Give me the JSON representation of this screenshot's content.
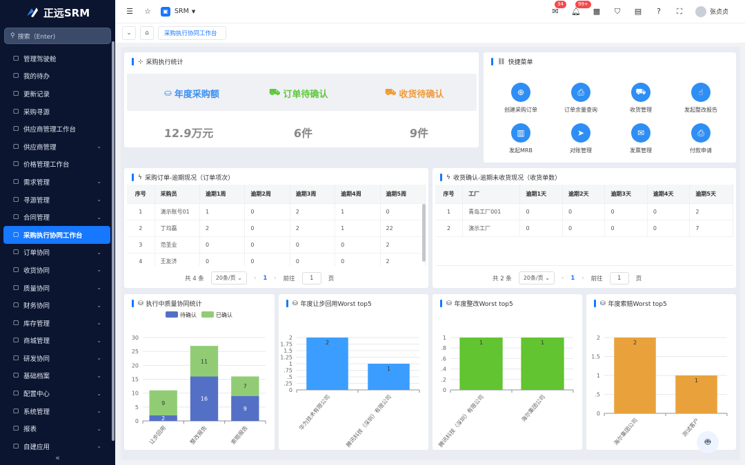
{
  "app": {
    "title": "正远SRM",
    "search_placeholder": "搜索（Enter)"
  },
  "sidebar": {
    "items": [
      {
        "label": "管理驾驶舱",
        "icon": "dashboard-icon",
        "chev": false
      },
      {
        "label": "我的待办",
        "icon": "user-icon",
        "chev": false
      },
      {
        "label": "更新记录",
        "icon": "box-icon",
        "chev": false
      },
      {
        "label": "采购寻源",
        "icon": "sparkle-icon",
        "chev": false
      },
      {
        "label": "供应商管理工作台",
        "icon": "monitor-icon",
        "chev": false
      },
      {
        "label": "供应商管理",
        "icon": "building-icon",
        "chev": true
      },
      {
        "label": "价格管理工作台",
        "icon": "monitor-icon",
        "chev": false
      },
      {
        "label": "需求管理",
        "icon": "folder-icon",
        "chev": true
      },
      {
        "label": "寻源管理",
        "icon": "inbox-icon",
        "chev": true
      },
      {
        "label": "合同管理",
        "icon": "person-icon",
        "chev": true
      },
      {
        "label": "采购执行协同工作台",
        "icon": "monitor-icon",
        "chev": false,
        "active": true
      },
      {
        "label": "订单协同",
        "icon": "monitor-icon",
        "chev": true
      },
      {
        "label": "收货协同",
        "icon": "box-icon",
        "chev": true
      },
      {
        "label": "质量协同",
        "icon": "shield-icon",
        "chev": true
      },
      {
        "label": "财务协同",
        "icon": "eye-icon",
        "chev": true
      },
      {
        "label": "库存管理",
        "icon": "warehouse-icon",
        "chev": true
      },
      {
        "label": "商城管理",
        "icon": "shop-icon",
        "chev": true
      },
      {
        "label": "研发协同",
        "icon": "briefcase-icon",
        "chev": true
      },
      {
        "label": "基础档案",
        "icon": "car-icon",
        "chev": true
      },
      {
        "label": "配置中心",
        "icon": "calendar-icon",
        "chev": true
      },
      {
        "label": "系统管理",
        "icon": "gear-icon",
        "chev": true
      },
      {
        "label": "报表",
        "icon": "chart-icon",
        "chev": true
      },
      {
        "label": "自建应用",
        "icon": "home-icon",
        "chev": true
      }
    ]
  },
  "topbar": {
    "module": "SRM",
    "badge1": "34",
    "badge2": "99+",
    "user": "张贞贞"
  },
  "tabs": {
    "active": "采购执行协同工作台"
  },
  "stats": {
    "title": "采购执行统计",
    "items": [
      {
        "label": "年度采购额",
        "value": "12.9万元",
        "color": "#3b8ff0"
      },
      {
        "label": "订单待确认",
        "value": "6件",
        "color": "#5cc83a"
      },
      {
        "label": "收货待确认",
        "value": "9件",
        "color": "#f09a36"
      }
    ]
  },
  "quick": {
    "title": "快捷菜单",
    "items": [
      {
        "label": "创建采购订单",
        "icon": "cart-plus-icon"
      },
      {
        "label": "订单余量查询",
        "icon": "printer-icon"
      },
      {
        "label": "收货管理",
        "icon": "truck-icon"
      },
      {
        "label": "发起整改报告",
        "icon": "hand-icon"
      },
      {
        "label": "发起MRB",
        "icon": "book-icon"
      },
      {
        "label": "对账管理",
        "icon": "send-icon"
      },
      {
        "label": "发票管理",
        "icon": "mail-icon"
      },
      {
        "label": "付款申请",
        "icon": "print-icon"
      }
    ]
  },
  "overdue_orders": {
    "title": "采购订单-逾期现况（订单项次）",
    "headers": [
      "序号",
      "采购员",
      "逾期1周",
      "逾期2周",
      "逾期3周",
      "逾期4周",
      "逾期5周"
    ],
    "rows": [
      [
        "1",
        "演示账号01",
        "1",
        "0",
        "2",
        "1",
        "0"
      ],
      [
        "2",
        "丁均磊",
        "2",
        "0",
        "2",
        "1",
        "22"
      ],
      [
        "3",
        "范圣业",
        "0",
        "0",
        "0",
        "0",
        "2"
      ],
      [
        "4",
        "王友济",
        "0",
        "0",
        "0",
        "0",
        "2"
      ]
    ],
    "total": "共 4 条",
    "page_size": "20条/页",
    "page": "1",
    "goto": "前往",
    "goto_val": "1",
    "page_unit": "页"
  },
  "overdue_receipts": {
    "title": "收货确认-逾期未收货现况（收货单数）",
    "headers": [
      "序号",
      "工厂",
      "逾期1天",
      "逾期2天",
      "逾期3天",
      "逾期4天",
      "逾期5天"
    ],
    "rows": [
      [
        "1",
        "青岛工厂001",
        "0",
        "0",
        "0",
        "0",
        "2"
      ],
      [
        "2",
        "演示工厂",
        "0",
        "0",
        "0",
        "0",
        "7"
      ]
    ],
    "total": "共 2 条",
    "page_size": "20条/页",
    "page": "1",
    "goto": "前往",
    "goto_val": "1",
    "page_unit": "页"
  },
  "chart_data": [
    {
      "type": "bar",
      "title": "执行中质量协同统计",
      "stacked": true,
      "categories": [
        "让步回用",
        "整改报告",
        "索赔报告"
      ],
      "series": [
        {
          "name": "待确认",
          "values": [
            2,
            16,
            9
          ],
          "color": "#5470c6"
        },
        {
          "name": "已确认",
          "values": [
            9,
            11,
            7
          ],
          "color": "#91cc75"
        }
      ],
      "ylim": [
        0,
        30
      ],
      "yticks": [
        0,
        5,
        10,
        15,
        20,
        25,
        30
      ],
      "legend": "top"
    },
    {
      "type": "bar",
      "title": "年度让步回用Worst top5",
      "categories": [
        "华为技术有限公司",
        "腾讯科技（深圳）有限公司"
      ],
      "values": [
        2,
        1
      ],
      "color": "#3b9dff",
      "ylim": [
        0,
        2
      ],
      "yticks": [
        0,
        0.25,
        0.5,
        0.75,
        1,
        1.25,
        1.5,
        1.75,
        2
      ],
      "ytick_labels": [
        "0",
        ".25",
        ".5",
        ".75",
        "1",
        "1.25",
        "1.5",
        "1.75",
        "2"
      ]
    },
    {
      "type": "bar",
      "title": "年度整改Worst top5",
      "categories": [
        "腾讯科技（深圳）有限公司",
        "海尔集团公司"
      ],
      "values": [
        1,
        1
      ],
      "color": "#62c430",
      "ylim": [
        0,
        1
      ],
      "yticks": [
        0,
        0.2,
        0.4,
        0.6,
        0.8,
        1
      ],
      "ytick_labels": [
        "0",
        ".2",
        ".4",
        ".6",
        ".8",
        "1"
      ]
    },
    {
      "type": "bar",
      "title": "年度索赔Worst top5",
      "categories": [
        "海尔集团公司",
        "测试客户"
      ],
      "values": [
        2,
        1
      ],
      "color": "#e9a23b",
      "ylim": [
        0,
        2
      ],
      "yticks": [
        0,
        0.5,
        1,
        1.5,
        2
      ],
      "ytick_labels": [
        "0",
        ".5",
        "1",
        "1.5",
        "2"
      ]
    }
  ]
}
